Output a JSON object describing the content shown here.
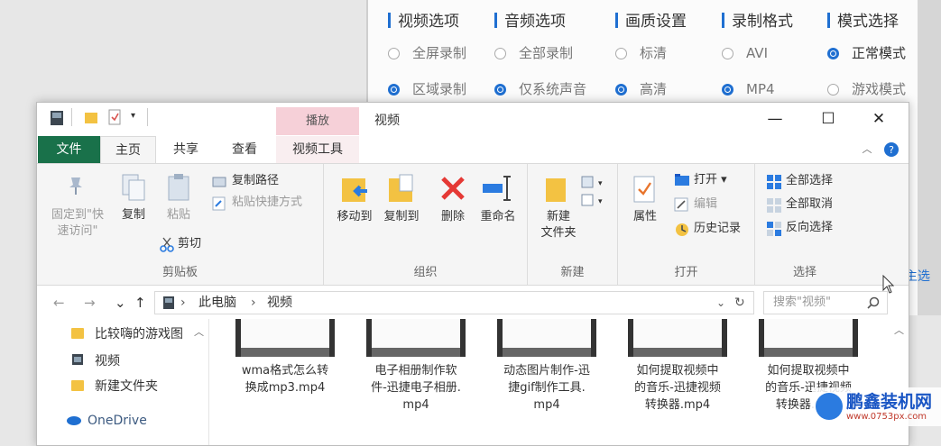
{
  "recorder": {
    "columns": [
      {
        "header": "视频选项",
        "options": [
          {
            "label": "全屏录制",
            "selected": false
          },
          {
            "label": "区域录制",
            "selected": true
          }
        ]
      },
      {
        "header": "音频选项",
        "options": [
          {
            "label": "全部录制",
            "selected": false
          },
          {
            "label": "仅系统声音",
            "selected": true
          }
        ]
      },
      {
        "header": "画质设置",
        "options": [
          {
            "label": "标清",
            "selected": false
          },
          {
            "label": "高清",
            "selected": true
          }
        ]
      },
      {
        "header": "录制格式",
        "options": [
          {
            "label": "AVI",
            "selected": false
          },
          {
            "label": "MP4",
            "selected": true
          }
        ]
      },
      {
        "header": "模式选择",
        "options": [
          {
            "label": "正常模式",
            "selected": true
          },
          {
            "label": "游戏模式",
            "selected": false
          }
        ]
      }
    ],
    "side_link": "主选",
    "accent": "#1f6fd1"
  },
  "explorer": {
    "context_tab_title": "播放",
    "window_title": "视频",
    "window_controls": {
      "minimize": "—",
      "maximize": "☐",
      "close": "✕"
    },
    "tabs": {
      "file": "文件",
      "home": "主页",
      "share": "共享",
      "view": "查看",
      "context": "视频工具"
    },
    "ribbon": {
      "clipboard": {
        "pin": "固定到\"快\n速访问\"",
        "copy": "复制",
        "paste": "粘贴",
        "copy_path": "复制路径",
        "paste_shortcut": "粘贴快捷方式",
        "cut": "剪切",
        "label": "剪贴板"
      },
      "organize": {
        "move_to": "移动到",
        "copy_to": "复制到",
        "delete": "删除",
        "rename": "重命名",
        "label": "组织"
      },
      "new": {
        "new_folder": "新建\n文件夹",
        "label": "新建"
      },
      "open": {
        "properties": "属性",
        "open": "打开 ▾",
        "edit": "编辑",
        "history": "历史记录",
        "label": "打开"
      },
      "select": {
        "select_all": "全部选择",
        "select_none": "全部取消",
        "invert": "反向选择",
        "label": "选择"
      }
    },
    "address": {
      "crumb1": "此电脑",
      "crumb2": "视频",
      "search_placeholder": "搜索\"视频\""
    },
    "nav_items": [
      "比较嗨的游戏图",
      "视频",
      "新建文件夹",
      "OneDrive"
    ],
    "files": [
      "wma格式怎么转\n换成mp3.mp4",
      "电子相册制作软\n件-迅捷电子相册.\nmp4",
      "动态图片制作-迅\n捷gif制作工具.\nmp4",
      "如何提取视频中\n的音乐-迅捷视频\n转换器.mp4",
      "如何提取视频中\n的音乐-迅捷视频\n转换器.mp4"
    ]
  },
  "watermark": {
    "brand": "鹏鑫装机网",
    "url": "www.0753px.com"
  }
}
